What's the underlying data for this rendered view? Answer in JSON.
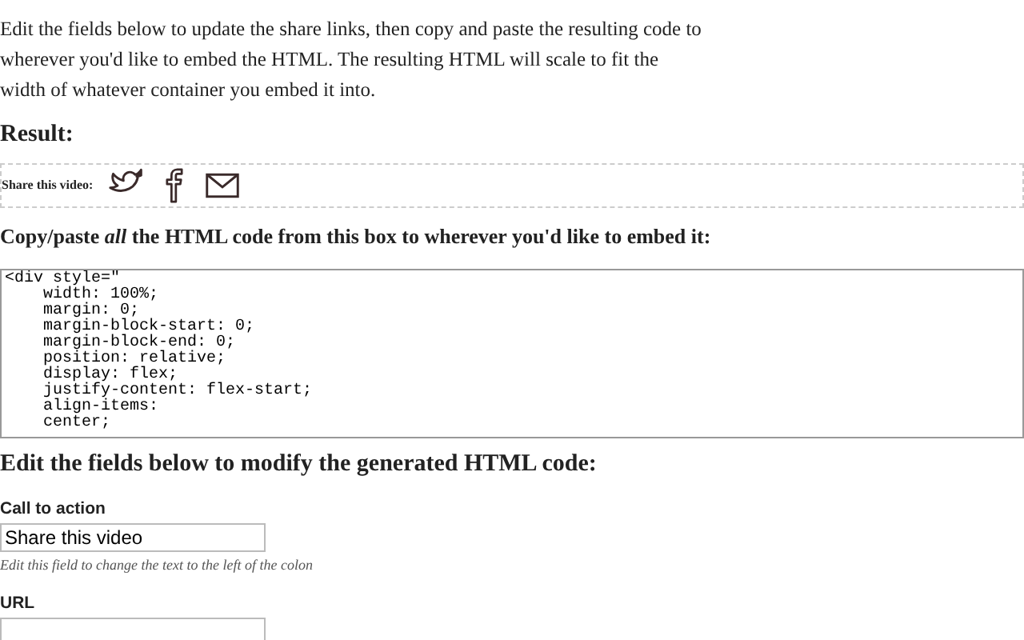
{
  "intro": "Edit the fields below to update the share links, then copy and paste the resulting code to wherever you'd like to embed the HTML. The resulting HTML will scale to fit the width of whatever container you embed it into.",
  "result_heading": "Result:",
  "share_bar": {
    "label": "Share this video:",
    "icons": [
      {
        "kind": "twitter"
      },
      {
        "kind": "facebook"
      },
      {
        "kind": "email"
      }
    ]
  },
  "copy_heading": "Copy/paste *all* the HTML code from this box to wherever you'd like to embed it:",
  "code": "<div style=\"\n    width: 100%;\n    margin: 0;\n    margin-block-start: 0;\n    margin-block-end: 0;\n    position: relative;\n    display: flex;\n    justify-content: flex-start;\n    align-items:\n    center;",
  "fields_heading": "Edit the fields below to modify the generated HTML code:",
  "fields": [
    {
      "label": "Call to action",
      "value": "Share this video",
      "hint": "Edit this field to change the text to the left of the colon"
    },
    {
      "label": "URL"
    }
  ]
}
